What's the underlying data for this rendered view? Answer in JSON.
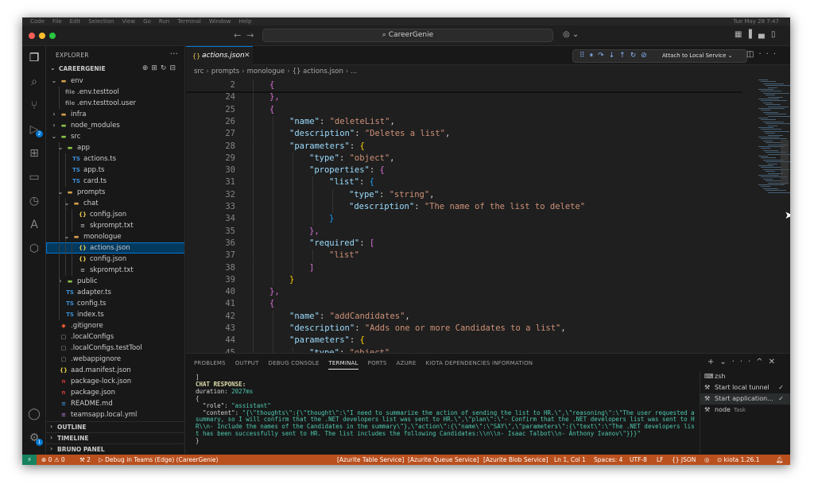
{
  "app": {
    "search_text": "CareerGenie",
    "mac_menus": [
      "Code",
      "File",
      "Edit",
      "Selection",
      "View",
      "Go",
      "Run",
      "Terminal",
      "Window",
      "Help"
    ],
    "clock": "Tue May 28  7:47"
  },
  "sidebar": {
    "title": "EXPLORER",
    "project": "CAREERGENIE",
    "tree": [
      {
        "d": 1,
        "chev": "v",
        "icon": "folder",
        "label": "env",
        "color": "#d8a14a"
      },
      {
        "d": 2,
        "chev": "",
        "icon": "file",
        "label": ".env.testtool",
        "color": "#888"
      },
      {
        "d": 2,
        "chev": "",
        "icon": "file",
        "label": ".env.testtool.user",
        "color": "#888"
      },
      {
        "d": 1,
        "chev": ">",
        "icon": "folder",
        "label": "infra",
        "color": "#d8a14a"
      },
      {
        "d": 1,
        "chev": ">",
        "icon": "folder",
        "label": "node_modules",
        "color": "#8bc34a"
      },
      {
        "d": 1,
        "chev": "v",
        "icon": "folder",
        "label": "src",
        "color": "#8bc34a"
      },
      {
        "d": 2,
        "chev": "v",
        "icon": "folder",
        "label": "app",
        "color": "#8bc34a"
      },
      {
        "d": 3,
        "chev": "",
        "icon": "TS",
        "label": "actions.ts",
        "color": "#3c8fd6"
      },
      {
        "d": 3,
        "chev": "",
        "icon": "TS",
        "label": "app.ts",
        "color": "#3c8fd6"
      },
      {
        "d": 3,
        "chev": "",
        "icon": "TS",
        "label": "card.ts",
        "color": "#3c8fd6"
      },
      {
        "d": 2,
        "chev": "v",
        "icon": "folder",
        "label": "prompts",
        "color": "#d8a14a"
      },
      {
        "d": 3,
        "chev": "v",
        "icon": "folder",
        "label": "chat",
        "color": "#d8a14a"
      },
      {
        "d": 4,
        "chev": "",
        "icon": "{}",
        "label": "config.json",
        "color": "#e6c84e"
      },
      {
        "d": 4,
        "chev": "",
        "icon": "≡",
        "label": "skprompt.txt",
        "color": "#aaaaaa"
      },
      {
        "d": 3,
        "chev": "v",
        "icon": "folder",
        "label": "monologue",
        "color": "#d8a14a"
      },
      {
        "d": 4,
        "chev": "",
        "icon": "{}",
        "label": "actions.json",
        "color": "#e6c84e",
        "selected": true
      },
      {
        "d": 4,
        "chev": "",
        "icon": "{}",
        "label": "config.json",
        "color": "#e6c84e"
      },
      {
        "d": 4,
        "chev": "",
        "icon": "≡",
        "label": "skprompt.txt",
        "color": "#aaaaaa"
      },
      {
        "d": 2,
        "chev": ">",
        "icon": "folder",
        "label": "public",
        "color": "#8bc34a"
      },
      {
        "d": 2,
        "chev": "",
        "icon": "TS",
        "label": "adapter.ts",
        "color": "#3c8fd6"
      },
      {
        "d": 2,
        "chev": "",
        "icon": "TS",
        "label": "config.ts",
        "color": "#3c8fd6"
      },
      {
        "d": 2,
        "chev": "",
        "icon": "TS",
        "label": "index.ts",
        "color": "#3c8fd6"
      },
      {
        "d": 1,
        "chev": "",
        "icon": "◆",
        "label": ".gitignore",
        "color": "#e4572e"
      },
      {
        "d": 1,
        "chev": "",
        "icon": "▢",
        "label": ".localConfigs",
        "color": "#aaaaaa"
      },
      {
        "d": 1,
        "chev": "",
        "icon": "▢",
        "label": ".localConfigs.testTool",
        "color": "#aaaaaa"
      },
      {
        "d": 1,
        "chev": "",
        "icon": "▢",
        "label": ".webappignore",
        "color": "#aaaaaa"
      },
      {
        "d": 1,
        "chev": "",
        "icon": "{}",
        "label": "aad.manifest.json",
        "color": "#e6c84e"
      },
      {
        "d": 1,
        "chev": "",
        "icon": "n",
        "label": "package-lock.json",
        "color": "#cb3837"
      },
      {
        "d": 1,
        "chev": "",
        "icon": "n",
        "label": "package.json",
        "color": "#cb3837"
      },
      {
        "d": 1,
        "chev": "",
        "icon": "≡",
        "label": "README.md",
        "color": "#3c8fd6"
      },
      {
        "d": 1,
        "chev": "",
        "icon": "≡",
        "label": "teamsapp.local.yml",
        "color": "#a074c4"
      },
      {
        "d": 1,
        "chev": "",
        "icon": "≡",
        "label": "teamsapp.testtool.yml",
        "color": "#a074c4"
      }
    ],
    "sections": [
      "OUTLINE",
      "TIMELINE",
      "BRUNO PANEL"
    ]
  },
  "editor": {
    "tab_label": "actions.json",
    "debug_config": "Attach to Local Service",
    "breadcrumbs": [
      "src",
      "prompts",
      "monologue",
      "{} actions.json",
      "..."
    ],
    "lines": [
      {
        "n": "2",
        "ind": 1,
        "t": [
          [
            "{",
            "p"
          ]
        ]
      },
      {
        "n": "24",
        "ind": 1,
        "t": [
          [
            "},",
            "p"
          ]
        ]
      },
      {
        "n": "25",
        "ind": 1,
        "t": [
          [
            "{",
            "p"
          ]
        ]
      },
      {
        "n": "26",
        "ind": 2,
        "t": [
          [
            "\"name\"",
            "k"
          ],
          [
            ": ",
            "w"
          ],
          [
            "\"deleteList\"",
            "s"
          ],
          [
            ",",
            "w"
          ]
        ]
      },
      {
        "n": "27",
        "ind": 2,
        "t": [
          [
            "\"description\"",
            "k"
          ],
          [
            ": ",
            "w"
          ],
          [
            "\"Deletes a list\"",
            "s"
          ],
          [
            ",",
            "w"
          ]
        ]
      },
      {
        "n": "28",
        "ind": 2,
        "t": [
          [
            "\"parameters\"",
            "k"
          ],
          [
            ": ",
            "w"
          ],
          [
            "{",
            "y"
          ]
        ]
      },
      {
        "n": "29",
        "ind": 3,
        "t": [
          [
            "\"type\"",
            "k"
          ],
          [
            ": ",
            "w"
          ],
          [
            "\"object\"",
            "s"
          ],
          [
            ",",
            "w"
          ]
        ]
      },
      {
        "n": "30",
        "ind": 3,
        "t": [
          [
            "\"properties\"",
            "k"
          ],
          [
            ": ",
            "w"
          ],
          [
            "{",
            "m"
          ]
        ]
      },
      {
        "n": "31",
        "ind": 4,
        "t": [
          [
            "\"list\"",
            "k"
          ],
          [
            ": ",
            "w"
          ],
          [
            "{",
            "b"
          ]
        ]
      },
      {
        "n": "32",
        "ind": 5,
        "t": [
          [
            "\"type\"",
            "k"
          ],
          [
            ": ",
            "w"
          ],
          [
            "\"string\"",
            "s"
          ],
          [
            ",",
            "w"
          ]
        ]
      },
      {
        "n": "33",
        "ind": 5,
        "t": [
          [
            "\"description\"",
            "k"
          ],
          [
            ": ",
            "w"
          ],
          [
            "\"The name of the list to delete\"",
            "s"
          ]
        ]
      },
      {
        "n": "34",
        "ind": 4,
        "t": [
          [
            "}",
            "b"
          ]
        ]
      },
      {
        "n": "35",
        "ind": 3,
        "t": [
          [
            "},",
            "m"
          ]
        ]
      },
      {
        "n": "36",
        "ind": 3,
        "t": [
          [
            "\"required\"",
            "k"
          ],
          [
            ": ",
            "w"
          ],
          [
            "[",
            "m"
          ]
        ]
      },
      {
        "n": "37",
        "ind": 4,
        "t": [
          [
            "\"list\"",
            "s"
          ]
        ]
      },
      {
        "n": "38",
        "ind": 3,
        "t": [
          [
            "]",
            "m"
          ]
        ]
      },
      {
        "n": "39",
        "ind": 2,
        "t": [
          [
            "}",
            "y"
          ]
        ]
      },
      {
        "n": "40",
        "ind": 1,
        "t": [
          [
            "},",
            "p"
          ]
        ]
      },
      {
        "n": "41",
        "ind": 1,
        "t": [
          [
            "{",
            "p"
          ]
        ]
      },
      {
        "n": "42",
        "ind": 2,
        "t": [
          [
            "\"name\"",
            "k"
          ],
          [
            ": ",
            "w"
          ],
          [
            "\"addCandidates\"",
            "s"
          ],
          [
            ",",
            "w"
          ]
        ]
      },
      {
        "n": "43",
        "ind": 2,
        "t": [
          [
            "\"description\"",
            "k"
          ],
          [
            ": ",
            "w"
          ],
          [
            "\"Adds one or more Candidates to a list\"",
            "s"
          ],
          [
            ",",
            "w"
          ]
        ]
      },
      {
        "n": "44",
        "ind": 2,
        "t": [
          [
            "\"parameters\"",
            "k"
          ],
          [
            ": ",
            "w"
          ],
          [
            "{",
            "y"
          ]
        ]
      },
      {
        "n": "45",
        "ind": 3,
        "t": [
          [
            "\"type\"",
            "k"
          ],
          [
            ": ",
            "w"
          ],
          [
            "\"object\"",
            "s"
          ],
          [
            ",",
            "w"
          ]
        ]
      }
    ],
    "colors": {
      "k": "#9cdcfe",
      "s": "#ce9178",
      "w": "#d4d4d4",
      "p": "#da70d6",
      "y": "#ffd700",
      "m": "#da70d6",
      "b": "#179fff"
    }
  },
  "panel": {
    "tabs": [
      "PROBLEMS",
      "OUTPUT",
      "DEBUG CONSOLE",
      "TERMINAL",
      "PORTS",
      "AZURE",
      "KIOTA DEPENDENCIES INFORMATION"
    ],
    "active_tab": "TERMINAL",
    "terminal": {
      "line1": "]",
      "header": "CHAT RESPONSE:",
      "duration_label": "duration: ",
      "duration_value": "2027ms",
      "open": "{",
      "role_line": "  \"role\": ",
      "role_value": "\"assistant\"",
      "content_label": "  \"content\": ",
      "content_value": "\"{\\\"thoughts\\\":{\\\"thought\\\":\\\"I need to summarize the action of sending the list to HR.\\\",\\\"reasoning\\\":\\\"The user requested a summary, so I will confirm that the .NET developers list was sent to HR.\\\",\\\"plan\\\":\\\"- Confirm that the .NET developers list was sent to HR\\\\n- Include the names of the Candidates in the summary\\\"},\\\"action\\\":{\\\"name\\\":\\\"SAY\\\",\\\"parameters\\\":{\\\"text\\\":\\\"The .NET developers list has been successfully sent to HR. The list includes the following Candidates:\\\\n\\\\n- Isaac Talbot\\\\n- Anthony Ivanov\\\"}}}\"",
      "close": "}"
    },
    "terminal_list": [
      {
        "label": "zsh",
        "sub": "",
        "check": false
      },
      {
        "label": "Start local tunnel",
        "sub": "",
        "check": true
      },
      {
        "label": "Start application...",
        "sub": "",
        "check": true,
        "selected": true
      },
      {
        "label": "node",
        "sub": "Task",
        "check": false
      }
    ]
  },
  "status": {
    "problems": "⊗ 0 ⚠ 0",
    "ports": "⚒ 2",
    "debug": "Debug in Teams (Edge) (CareerGenie)",
    "azurite_table": "[Azurite Table Service]",
    "azurite_queue": "[Azurite Queue Service]",
    "azurite_blob": "[Azurite Blob Service]",
    "position": "Ln 1, Col 1",
    "spaces": "Spaces: 4",
    "encoding": "UTF-8",
    "eol": "LF",
    "language": "{} JSON",
    "kiota": "kiota 1.26.1"
  }
}
